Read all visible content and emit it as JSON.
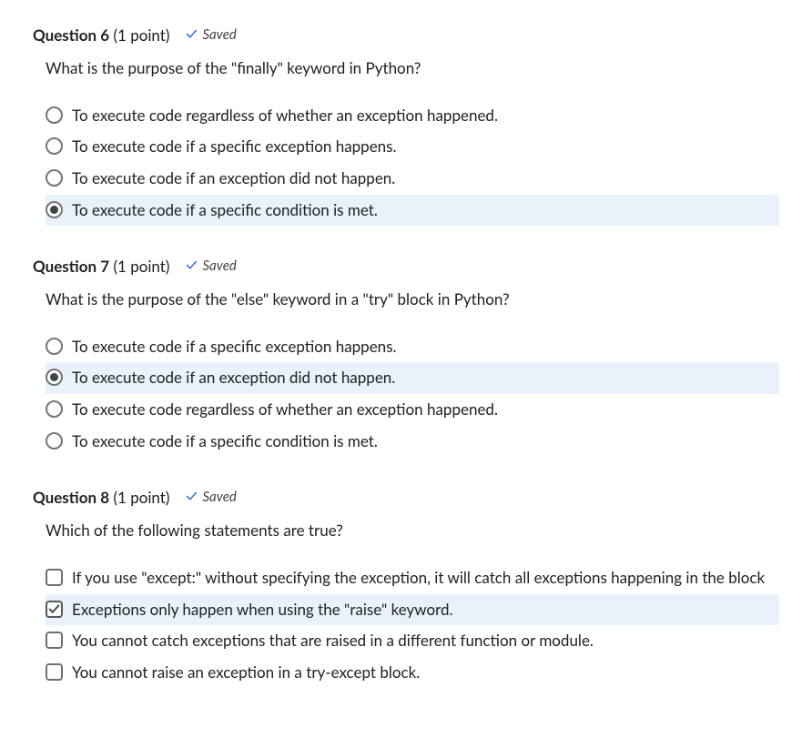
{
  "questions": [
    {
      "number": "6",
      "number_prefix": "Question ",
      "points": "(1 point)",
      "saved": "Saved",
      "prompt": "What is the purpose of the \"finally\" keyword in Python?",
      "type": "radio",
      "options": [
        {
          "label": "To execute code regardless of whether an exception happened.",
          "selected": false
        },
        {
          "label": "To execute code if a specific exception happens.",
          "selected": false
        },
        {
          "label": "To execute code if an exception did not happen.",
          "selected": false
        },
        {
          "label": "To execute code if a specific condition is met.",
          "selected": true
        }
      ]
    },
    {
      "number": "7",
      "number_prefix": "Question ",
      "points": "(1 point)",
      "saved": "Saved",
      "prompt": "What is the purpose of the \"else\" keyword in a \"try\" block in Python?",
      "type": "radio",
      "options": [
        {
          "label": "To execute code if a specific exception happens.",
          "selected": false
        },
        {
          "label": "To execute code if an exception did not happen.",
          "selected": true
        },
        {
          "label": "To execute code regardless of whether an exception happened.",
          "selected": false
        },
        {
          "label": "To execute code if a specific condition is met.",
          "selected": false
        }
      ]
    },
    {
      "number": "8",
      "number_prefix": "Question ",
      "points": "(1 point)",
      "saved": "Saved",
      "prompt": "Which of the following statements are true?",
      "type": "checkbox",
      "options": [
        {
          "label": "If you use \"except:\" without specifying the exception, it will catch all exceptions happening in the block",
          "selected": false
        },
        {
          "label": "Exceptions only happen when using the \"raise\" keyword.",
          "selected": true
        },
        {
          "label": "You cannot catch exceptions that are raised in a different function or module.",
          "selected": false
        },
        {
          "label": "You cannot raise an exception in a try-except block.",
          "selected": false
        }
      ]
    }
  ]
}
